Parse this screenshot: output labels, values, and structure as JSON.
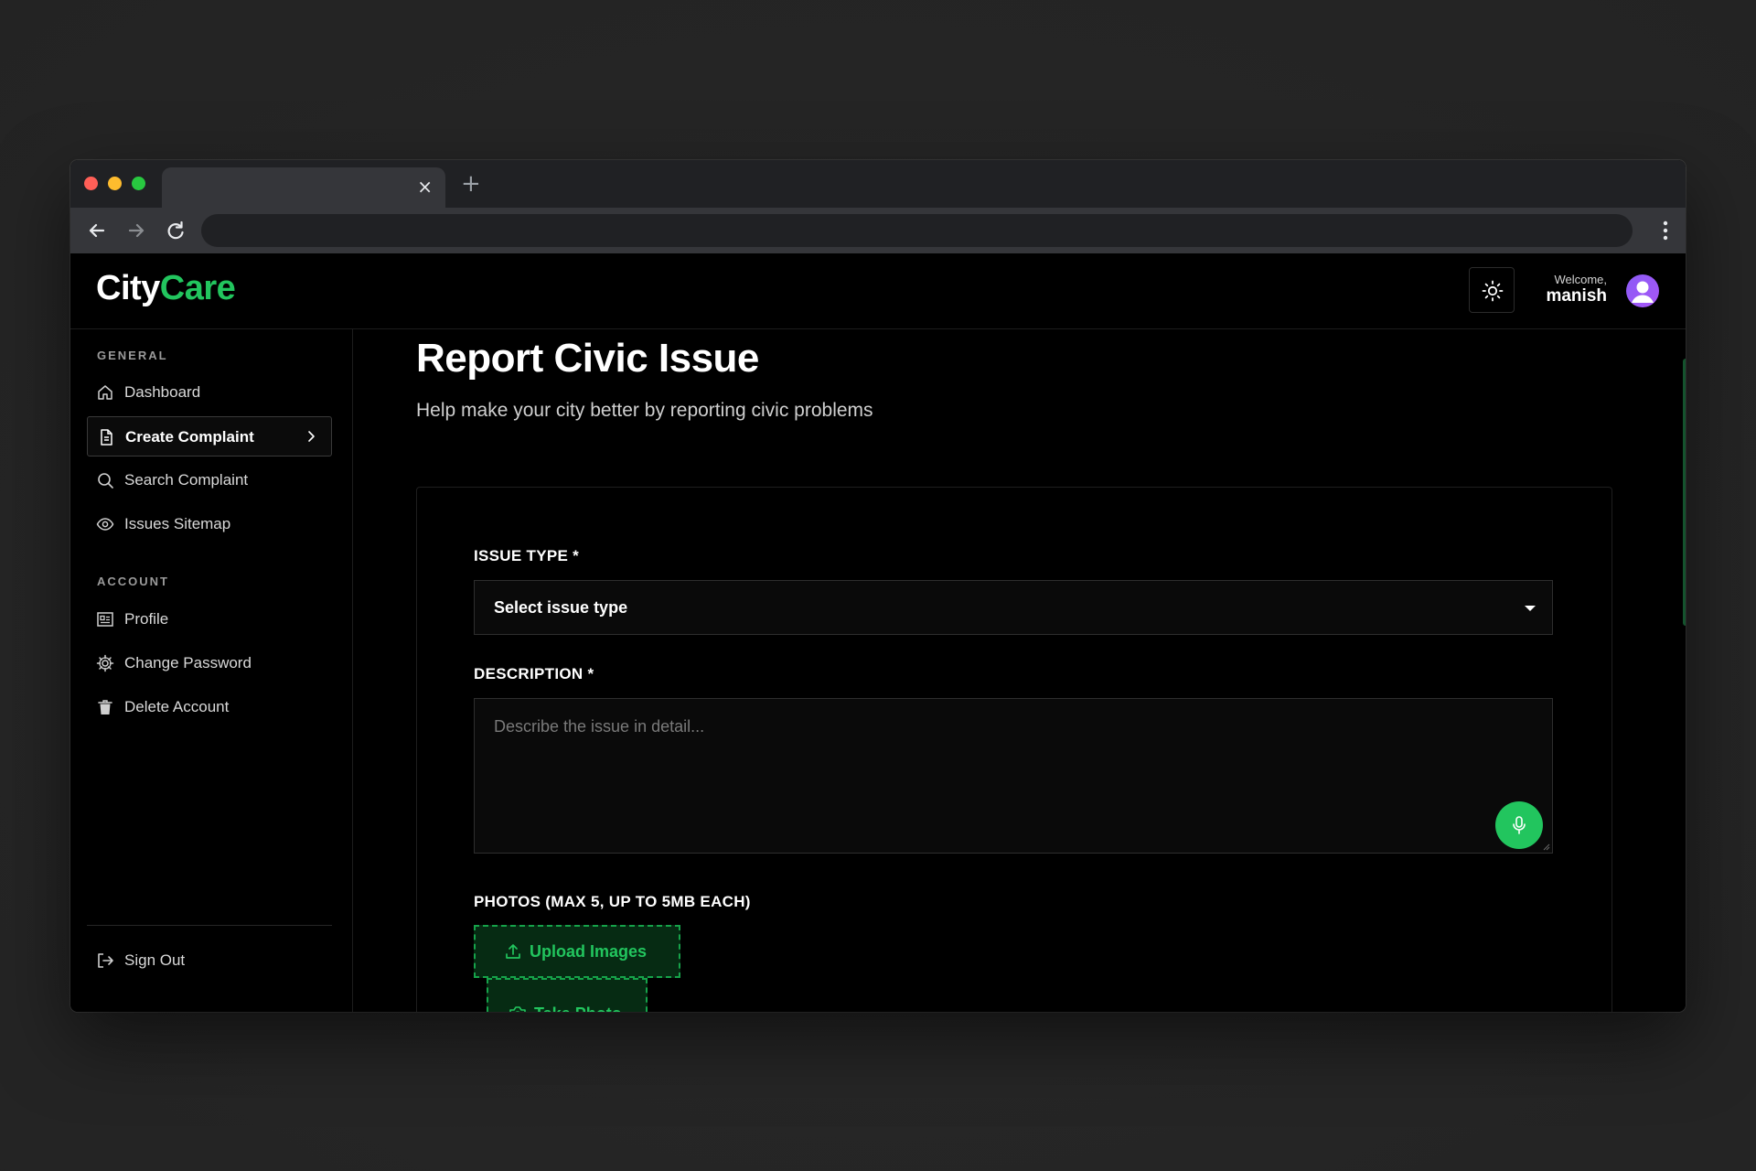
{
  "browser": {
    "tab_close": "×",
    "new_tab": "+"
  },
  "app": {
    "logo_part1": "City",
    "logo_part2": "Care",
    "brand_color": "#22c55e",
    "welcome_label": "Welcome,",
    "username": "manish"
  },
  "sidebar": {
    "general_label": "GENERAL",
    "account_label": "ACCOUNT",
    "items": [
      {
        "label": "Dashboard",
        "icon": "home-icon"
      },
      {
        "label": "Create Complaint",
        "icon": "document-icon",
        "active": true
      },
      {
        "label": "Search Complaint",
        "icon": "search-icon"
      },
      {
        "label": "Issues Sitemap",
        "icon": "eye-icon"
      }
    ],
    "account_items": [
      {
        "label": "Profile",
        "icon": "profile-card-icon"
      },
      {
        "label": "Change Password",
        "icon": "gear-icon"
      },
      {
        "label": "Delete Account",
        "icon": "trash-icon"
      }
    ],
    "sign_out": "Sign Out"
  },
  "main": {
    "title": "Report Civic Issue",
    "subtitle": "Help make your city better by reporting civic problems",
    "issue_type_label": "ISSUE TYPE *",
    "issue_type_value": "Select issue type",
    "description_label": "DESCRIPTION *",
    "description_placeholder": "Describe the issue in detail...",
    "photos_label": "PHOTOS (MAX 5, UP TO 5MB EACH)",
    "upload_label": "Upload Images",
    "take_photo_label": "Take Photo"
  }
}
